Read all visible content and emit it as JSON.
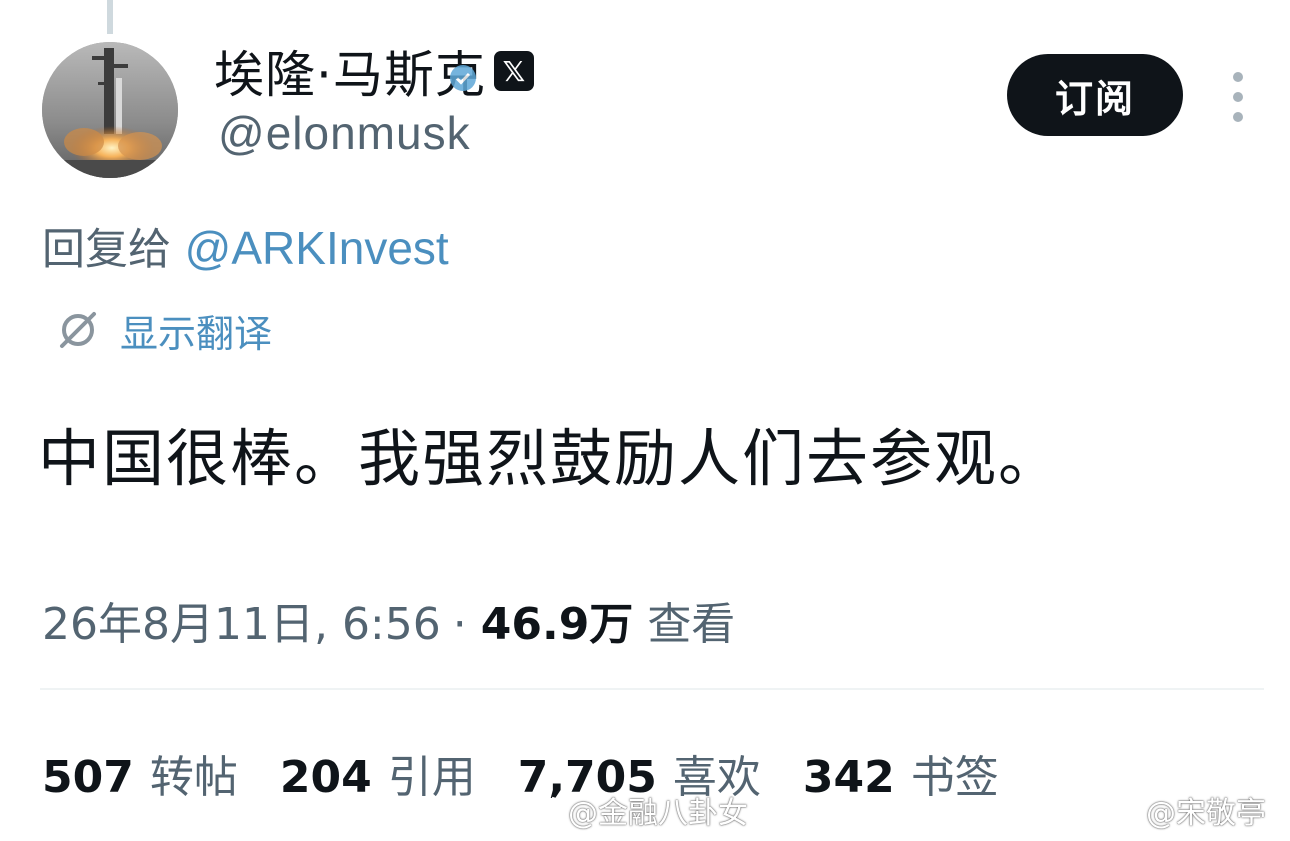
{
  "tweet": {
    "author": {
      "display_name": "埃隆·马斯克",
      "handle": "@elonmusk",
      "avatar_icon": "rocket-launch-avatar",
      "badge_icon": "x-logo-icon",
      "verified_icon": "verified-badge-icon"
    },
    "subscribe_label": "订阅",
    "more_icon": "more-vertical-icon",
    "reply_prefix": "回复给",
    "reply_mention": "@ARKInvest",
    "translate_icon": "translate-icon",
    "translate_label": "显示翻译",
    "text": "中国很棒。我强烈鼓励人们去参观。",
    "date": "26年8月11日, 6:56",
    "separator": "·",
    "views_count": "46.9万",
    "views_label": "查看",
    "stats": [
      {
        "count": "507",
        "label": "转帖"
      },
      {
        "count": "204",
        "label": "引用"
      },
      {
        "count": "7,705",
        "label": "喜欢"
      },
      {
        "count": "342",
        "label": "书签"
      }
    ]
  },
  "watermarks": [
    {
      "text": "@金融八卦女",
      "icon": "weibo-icon"
    },
    {
      "text": "@宋敬亭",
      "icon": "weibo-icon"
    }
  ],
  "colors": {
    "text_primary": "#0f1419",
    "text_secondary": "#536471",
    "link": "#4b8fbf",
    "button_bg": "#0f1419",
    "divider": "#eff3f4"
  }
}
